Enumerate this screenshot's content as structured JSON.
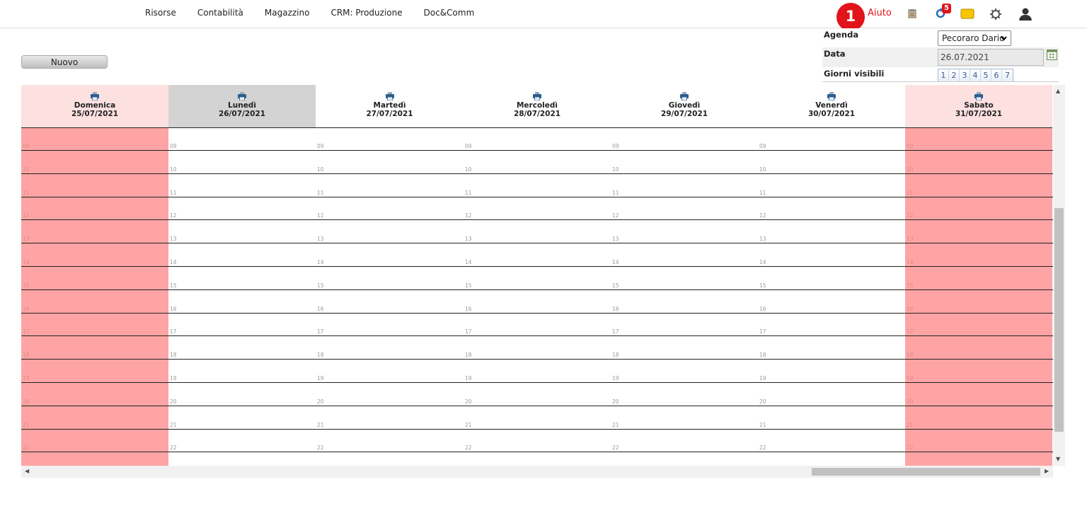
{
  "nav": {
    "menu": [
      "Risorse",
      "Contabilità",
      "Magazzino",
      "CRM: Produzione",
      "Doc&Comm"
    ],
    "help_label": "Aiuto",
    "callout_number": "1",
    "notification_count": "5",
    "accent_color": "#e1131b"
  },
  "toolbar": {
    "new_label": "Nuovo"
  },
  "filters": {
    "agenda_label": "Agenda",
    "agenda_value": "Pecoraro Dario",
    "date_label": "Data",
    "date_value": "26.07.2021",
    "visible_days_label": "Giorni visibili",
    "visible_days": [
      "1",
      "2",
      "3",
      "4",
      "5",
      "6",
      "7"
    ]
  },
  "calendar": {
    "weekend_color": "#fea4a4",
    "selected_header_color": "#d3d3d3",
    "days": [
      {
        "name": "Domenica",
        "date": "25/07/2021",
        "weekend": true,
        "selected": false
      },
      {
        "name": "Lunedì",
        "date": "26/07/2021",
        "weekend": false,
        "selected": true
      },
      {
        "name": "Martedì",
        "date": "27/07/2021",
        "weekend": false,
        "selected": false
      },
      {
        "name": "Mercoledì",
        "date": "28/07/2021",
        "weekend": false,
        "selected": false
      },
      {
        "name": "Giovedì",
        "date": "29/07/2021",
        "weekend": false,
        "selected": false
      },
      {
        "name": "Venerdì",
        "date": "30/07/2021",
        "weekend": false,
        "selected": false
      },
      {
        "name": "Sabato",
        "date": "31/07/2021",
        "weekend": true,
        "selected": false
      }
    ],
    "hours": [
      "09",
      "10",
      "11",
      "12",
      "13",
      "14",
      "15",
      "16",
      "17",
      "18",
      "19",
      "20",
      "21",
      "22"
    ]
  }
}
